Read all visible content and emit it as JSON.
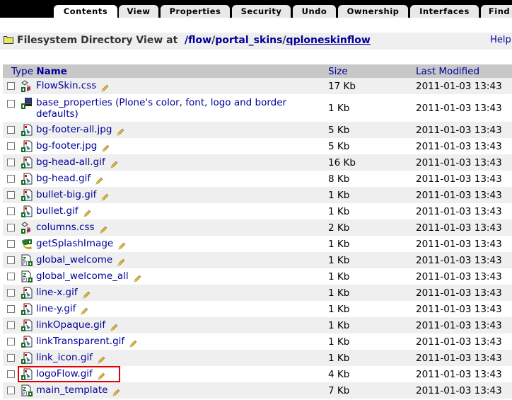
{
  "tabs": [
    {
      "label": "Contents",
      "active": true
    },
    {
      "label": "View"
    },
    {
      "label": "Properties"
    },
    {
      "label": "Security"
    },
    {
      "label": "Undo"
    },
    {
      "label": "Ownership"
    },
    {
      "label": "Interfaces"
    },
    {
      "label": "Find"
    }
  ],
  "title": {
    "prefix": "Filesystem Directory View at",
    "path_1": "/flow",
    "sep_1": "/",
    "path_2": "portal_skins",
    "sep_2": "/",
    "path_3": "qploneskinflow",
    "help": "Help!"
  },
  "table": {
    "headers": {
      "type": "Type",
      "name": "Name",
      "size": "Size",
      "modified": "Last Modified"
    },
    "rows": [
      {
        "name": "FlowSkin.css",
        "icon": "css-file-icon",
        "size": "17 Kb",
        "modified": "2011-01-03 13:43"
      },
      {
        "name": "base_properties (Plone's color, font, logo and border defaults)",
        "icon": "properties-file-icon",
        "size": "1 Kb",
        "modified": "2011-01-03 13:43"
      },
      {
        "name": "bg-footer-all.jpg",
        "icon": "image-file-icon",
        "size": "5 Kb",
        "modified": "2011-01-03 13:43"
      },
      {
        "name": "bg-footer.jpg",
        "icon": "image-file-icon",
        "size": "5 Kb",
        "modified": "2011-01-03 13:43"
      },
      {
        "name": "bg-head-all.gif",
        "icon": "image-file-icon",
        "size": "16 Kb",
        "modified": "2011-01-03 13:43"
      },
      {
        "name": "bg-head.gif",
        "icon": "image-file-icon",
        "size": "8 Kb",
        "modified": "2011-01-03 13:43"
      },
      {
        "name": "bullet-big.gif",
        "icon": "image-file-icon",
        "size": "1 Kb",
        "modified": "2011-01-03 13:43"
      },
      {
        "name": "bullet.gif",
        "icon": "image-file-icon",
        "size": "1 Kb",
        "modified": "2011-01-03 13:43"
      },
      {
        "name": "columns.css",
        "icon": "css-file-icon",
        "size": "2 Kb",
        "modified": "2011-01-03 13:43"
      },
      {
        "name": "getSplashImage",
        "icon": "python-script-icon",
        "size": "1 Kb",
        "modified": "2011-01-03 13:43"
      },
      {
        "name": "global_welcome",
        "icon": "page-template-icon",
        "size": "1 Kb",
        "modified": "2011-01-03 13:43"
      },
      {
        "name": "global_welcome_all",
        "icon": "page-template-icon",
        "size": "1 Kb",
        "modified": "2011-01-03 13:43"
      },
      {
        "name": "line-x.gif",
        "icon": "image-file-icon",
        "size": "1 Kb",
        "modified": "2011-01-03 13:43"
      },
      {
        "name": "line-y.gif",
        "icon": "image-file-icon",
        "size": "1 Kb",
        "modified": "2011-01-03 13:43"
      },
      {
        "name": "linkOpaque.gif",
        "icon": "image-file-icon",
        "size": "1 Kb",
        "modified": "2011-01-03 13:43"
      },
      {
        "name": "linkTransparent.gif",
        "icon": "image-file-icon",
        "size": "1 Kb",
        "modified": "2011-01-03 13:43"
      },
      {
        "name": "link_icon.gif",
        "icon": "image-file-icon",
        "size": "1 Kb",
        "modified": "2011-01-03 13:43"
      },
      {
        "name": "logoFlow.gif",
        "icon": "image-file-icon",
        "size": "4 Kb",
        "modified": "2011-01-03 13:43",
        "highlighted": true
      },
      {
        "name": "main_template",
        "icon": "page-template-icon",
        "size": "7 Kb",
        "modified": "2011-01-03 13:43"
      }
    ]
  },
  "colors": {
    "link": "#000099",
    "header_bg": "#c8c8c8",
    "row_alt": "#efefef",
    "highlight": "#e00000"
  }
}
